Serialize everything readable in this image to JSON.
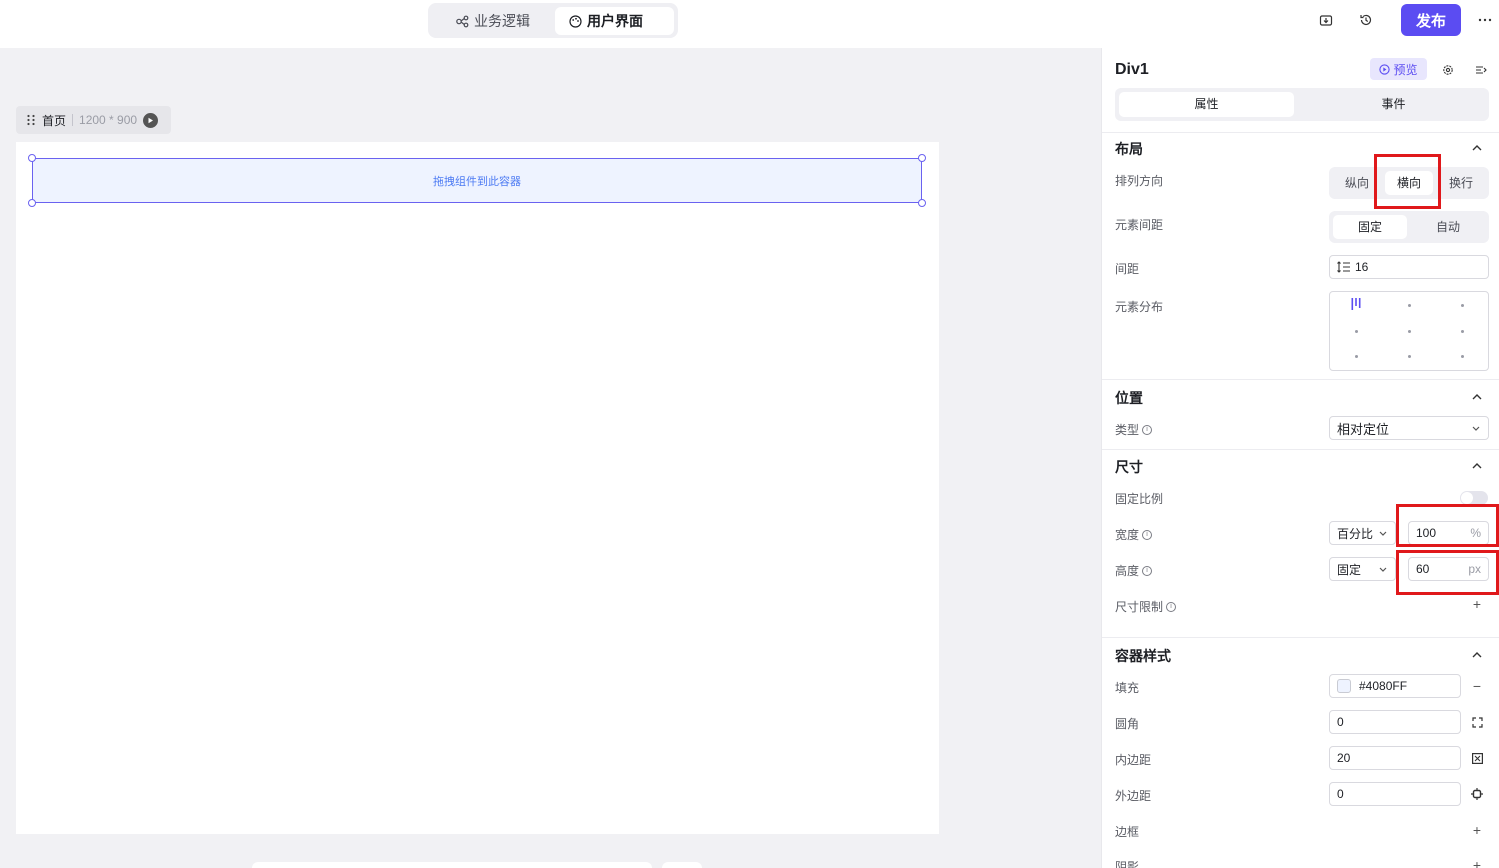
{
  "topbar": {
    "tabs": [
      {
        "label": "业务逻辑",
        "icon": "logic-flow-icon",
        "active": false
      },
      {
        "label": "用户界面",
        "icon": "palette-icon",
        "active": true
      }
    ],
    "publish_label": "发布",
    "more_icon": "more-icon"
  },
  "canvas": {
    "page_name": "首页",
    "page_size": "1200 * 900",
    "drop_hint": "拖拽组件到此容器"
  },
  "panel": {
    "title": "Div1",
    "preview_label": "预览",
    "tabs": [
      "属性",
      "事件"
    ],
    "layout": {
      "section": "布局",
      "direction_label": "排列方向",
      "direction_options": [
        "纵向",
        "横向",
        "换行"
      ],
      "spacing_label": "元素间距",
      "spacing_options": [
        "固定",
        "自动"
      ],
      "gap_label": "间距",
      "gap_value": "16",
      "distribution_label": "元素分布"
    },
    "position": {
      "section": "位置",
      "type_label": "类型",
      "type_value": "相对定位"
    },
    "size": {
      "section": "尺寸",
      "ratio_label": "固定比例",
      "width_label": "宽度",
      "width_mode": "百分比",
      "width_value": "100",
      "width_unit": "%",
      "height_label": "高度",
      "height_mode": "固定",
      "height_value": "60",
      "height_unit": "px",
      "limit_label": "尺寸限制"
    },
    "style": {
      "section": "容器样式",
      "fill_label": "填充",
      "fill_value": "#4080FF",
      "radius_label": "圆角",
      "radius_value": "0",
      "padding_label": "内边距",
      "padding_value": "20",
      "margin_label": "外边距",
      "margin_value": "0",
      "border_label": "边框",
      "shadow_label": "阴影"
    }
  },
  "colors": {
    "accent": "#5b4cf2",
    "highlight": "#e0181b"
  }
}
